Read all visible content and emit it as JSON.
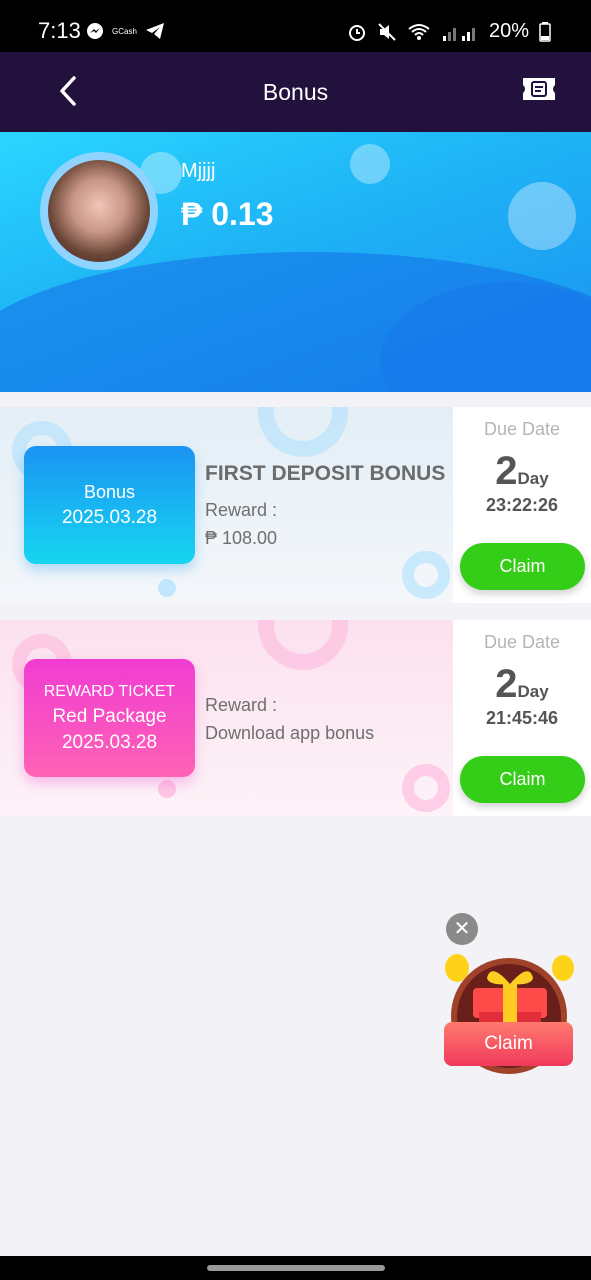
{
  "status_bar": {
    "time": "7:13",
    "gcash_label": "GCash",
    "battery": "20%",
    "icons": [
      "messenger-icon",
      "gcash-icon",
      "telegram-icon",
      "alarm-icon",
      "mute-icon",
      "wifi-icon",
      "signal-icon",
      "battery-icon"
    ]
  },
  "header": {
    "title": "Bonus",
    "back_icon": "chevron-left-icon",
    "ticket_icon": "ticket-icon"
  },
  "profile": {
    "username": "Mjjjj",
    "balance": "₱ 0.13"
  },
  "cards": [
    {
      "tag_title": "Bonus",
      "tag_date": "2025.03.28",
      "heading": "FIRST DEPOSIT BONUS",
      "reward_label": "Reward :",
      "reward_value": "₱ 108.00",
      "due_label": "Due Date",
      "days": "2",
      "day_unit": "Day",
      "countdown": "23:22:26",
      "claim_label": "Claim"
    },
    {
      "tag_small": "REWARD TICKET",
      "tag_title": "Red Package",
      "tag_date": "2025.03.28",
      "reward_label": "Reward :",
      "reward_value": "Download app bonus",
      "due_label": "Due Date",
      "days": "2",
      "day_unit": "Day",
      "countdown": "21:45:46",
      "claim_label": "Claim"
    }
  ],
  "floating_gift": {
    "close_symbol": "✕",
    "claim_label": "Claim",
    "icon": "gift-box-icon"
  },
  "colors": {
    "header_bg": "#22103d",
    "claim_green": "#34cd17",
    "banner_blue": "#1fb6f6",
    "tag_blue": "#1b93f3",
    "tag_pink": "#f03cd3"
  }
}
